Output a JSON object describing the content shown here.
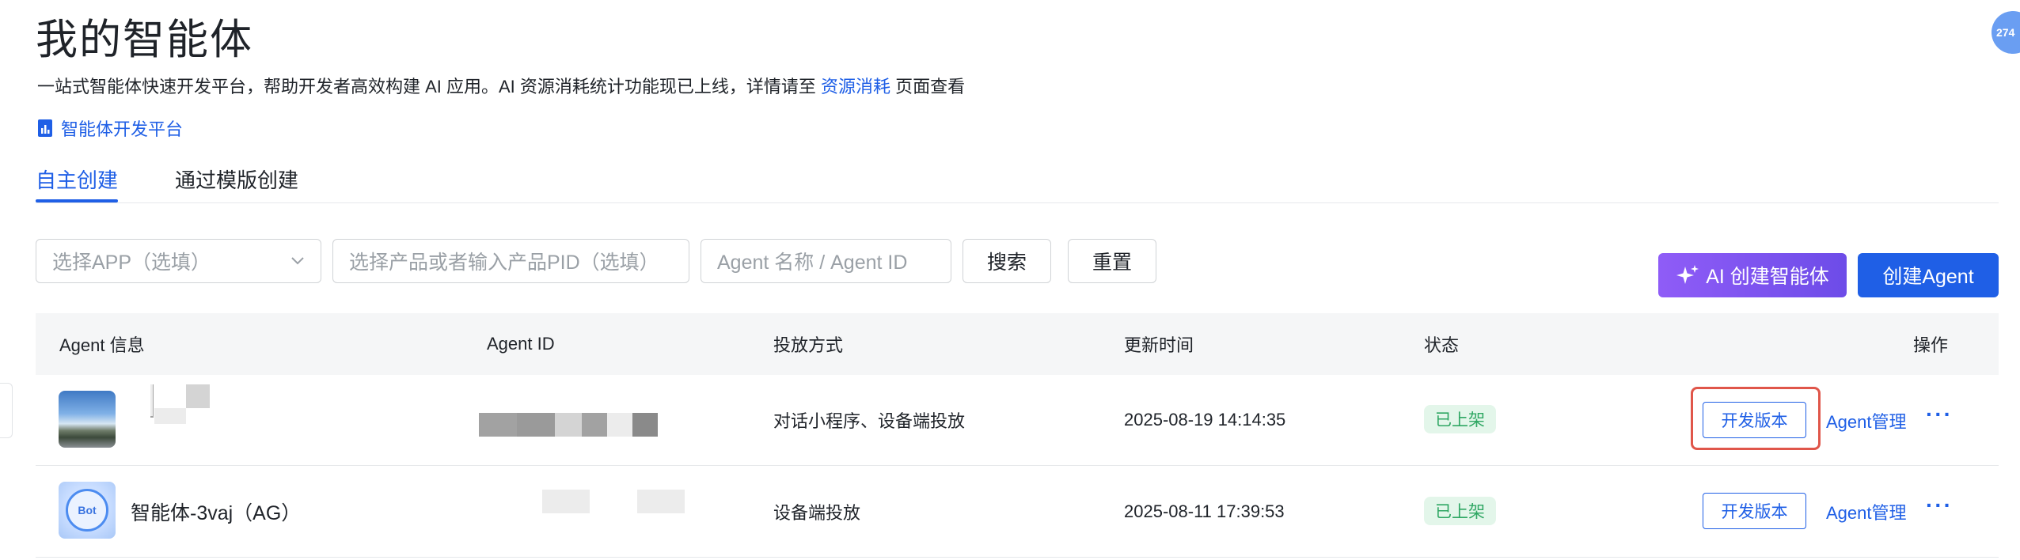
{
  "header": {
    "title": "我的智能体",
    "description_prefix": "一站式智能体快速开发平台，帮助开发者高效构建 AI 应用。AI 资源消耗统计功能现已上线，详情请至 ",
    "description_link": "资源消耗",
    "description_suffix": " 页面查看",
    "dev_platform_link": "智能体开发平台"
  },
  "tabs": [
    {
      "label": "自主创建",
      "active": true
    },
    {
      "label": "通过模版创建",
      "active": false
    }
  ],
  "filters": {
    "app_select_placeholder": "选择APP（选填）",
    "product_placeholder": "选择产品或者输入产品PID（选填）",
    "agent_placeholder": "Agent 名称 / Agent ID",
    "search_label": "搜索",
    "reset_label": "重置"
  },
  "actions": {
    "ai_create_label": "AI 创建智能体",
    "create_label": "创建Agent"
  },
  "table": {
    "columns": [
      "Agent 信息",
      "Agent ID",
      "投放方式",
      "更新时间",
      "状态",
      "操作"
    ],
    "rows": [
      {
        "name": "",
        "agent_id": "",
        "delivery": "对话小程序、设备端投放",
        "updated": "2025-08-19 14:14:35",
        "status": "已上架",
        "dev_version_label": "开发版本",
        "manage_label": "Agent管理",
        "more_label": "···"
      },
      {
        "name": "智能体-3vaj（AG）",
        "agent_id": "",
        "delivery": "设备端投放",
        "updated": "2025-08-11 17:39:53",
        "status": "已上架",
        "dev_version_label": "开发版本",
        "manage_label": "Agent管理",
        "more_label": "···"
      }
    ]
  },
  "corner_badge": "274",
  "avatar_bot_text": "Bot",
  "colors": {
    "primary": "#1f5fe6",
    "ai_gradient_start": "#8f5cf7",
    "ai_gradient_end": "#6d4ce8",
    "status_green": "#2fa763",
    "highlight_red": "#e0564a"
  }
}
